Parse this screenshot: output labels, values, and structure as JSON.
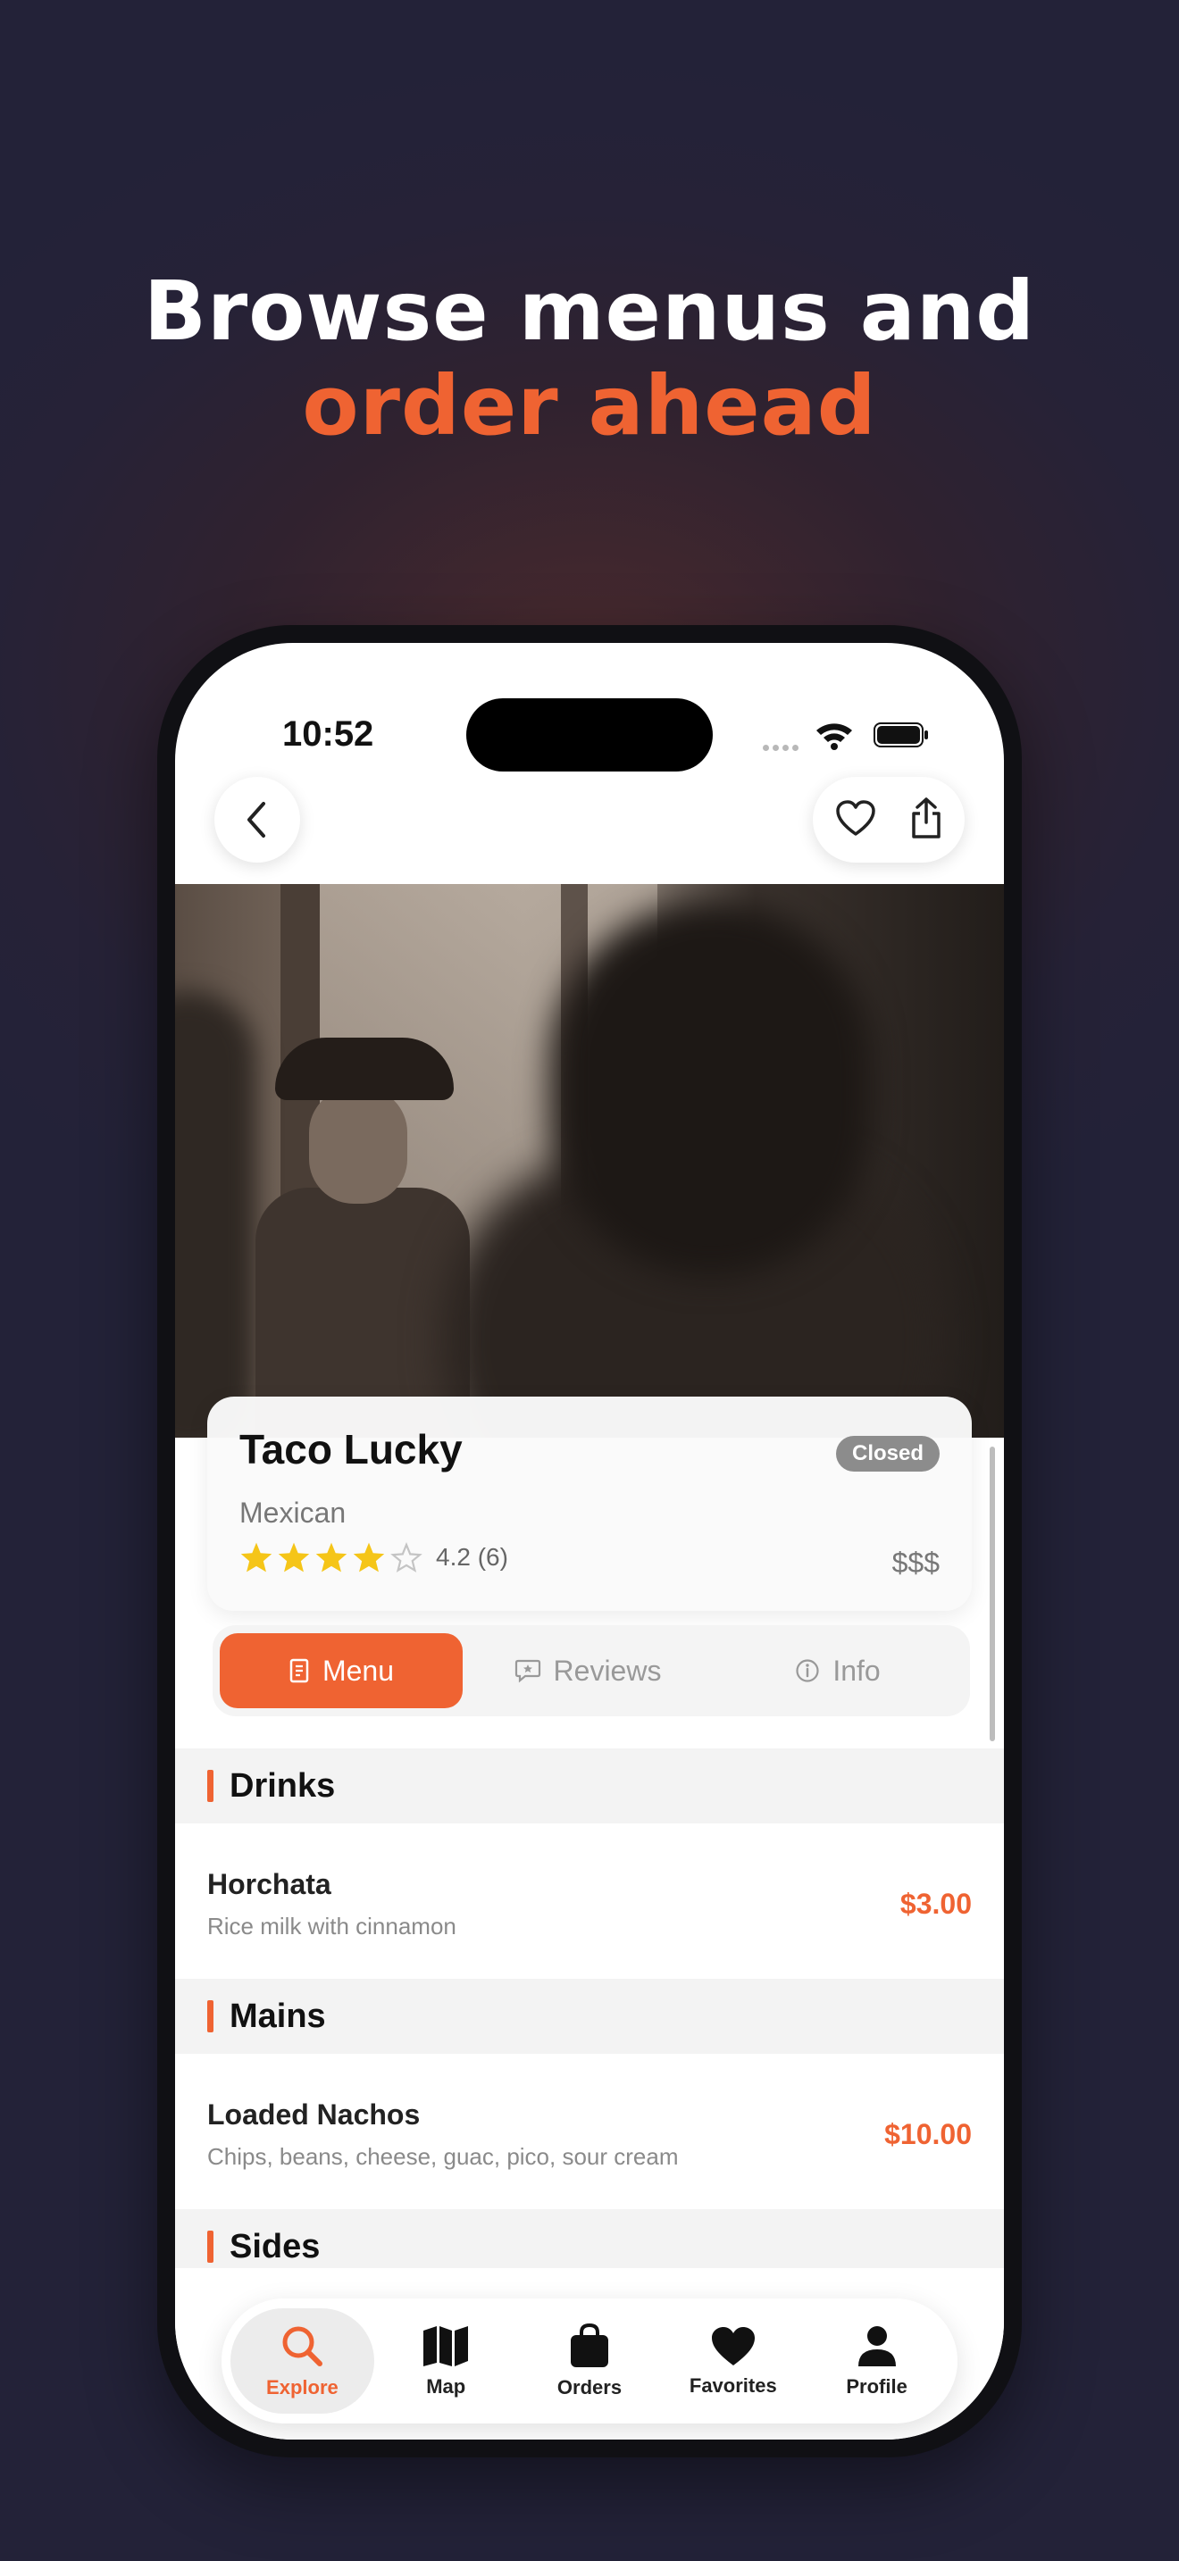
{
  "headline": {
    "line1": "Browse menus and",
    "line2": "order ahead"
  },
  "status_bar": {
    "time": "10:52"
  },
  "restaurant": {
    "name": "Taco Lucky",
    "status": "Closed",
    "cuisine": "Mexican",
    "rating_value": 4.2,
    "rating_text": "4.2 (6)",
    "price_level": "$$$",
    "stars_filled": 4,
    "stars_total": 5
  },
  "tabs": [
    {
      "label": "Menu",
      "icon": "menu-book-icon",
      "active": true
    },
    {
      "label": "Reviews",
      "icon": "chat-bubble-icon",
      "active": false
    },
    {
      "label": "Info",
      "icon": "info-icon",
      "active": false
    }
  ],
  "menu": {
    "sections": [
      {
        "title": "Drinks",
        "items": [
          {
            "name": "Horchata",
            "description": "Rice milk with cinnamon",
            "price": "$3.00"
          }
        ]
      },
      {
        "title": "Mains",
        "items": [
          {
            "name": "Loaded Nachos",
            "description": "Chips, beans, cheese, guac, pico, sour cream",
            "price": "$10.00"
          }
        ]
      },
      {
        "title": "Sides",
        "items": []
      }
    ]
  },
  "tab_bar": [
    {
      "label": "Explore",
      "icon": "search-icon",
      "active": true
    },
    {
      "label": "Map",
      "icon": "map-icon",
      "active": false
    },
    {
      "label": "Orders",
      "icon": "bag-icon",
      "active": false
    },
    {
      "label": "Favorites",
      "icon": "heart-icon",
      "active": false
    },
    {
      "label": "Profile",
      "icon": "person-icon",
      "active": false
    }
  ],
  "colors": {
    "accent": "#ef6332",
    "background": "#262237",
    "star": "#f5c518"
  }
}
